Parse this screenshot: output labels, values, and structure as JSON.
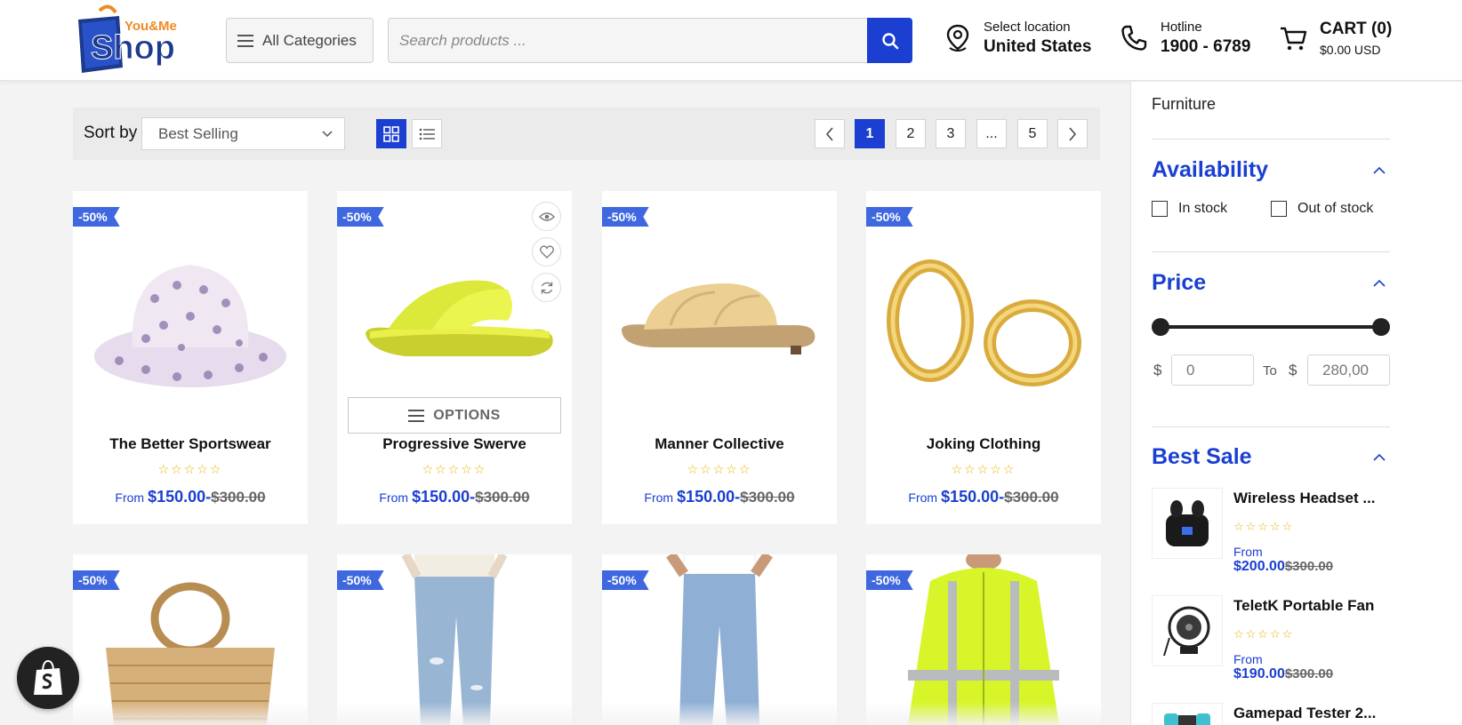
{
  "header": {
    "logo_text_top": "You&Me",
    "logo_text_main": "Shop",
    "categories_label": "All Categories",
    "search_placeholder": "Search products ...",
    "location_label": "Select location",
    "location_value": "United States",
    "hotline_label": "Hotline",
    "hotline_value": "1900 - 6789",
    "cart_label": "CART (0)",
    "cart_total": "$0.00 USD"
  },
  "toolbar": {
    "sort_label": "Sort by",
    "sort_value": "Best Selling",
    "pages": [
      "1",
      "2",
      "3",
      "...",
      "5"
    ],
    "current_page": "1"
  },
  "products": [
    {
      "badge": "-50%",
      "name": "The Better Sportswear",
      "stars": "☆☆☆☆☆",
      "from": "From",
      "price": "$150.00",
      "old_price": "$300.00",
      "image": "bucket-hat"
    },
    {
      "badge": "-50%",
      "name": "Progressive Swerve",
      "stars": "☆☆☆☆☆",
      "from": "From",
      "price": "$150.00",
      "old_price": "$300.00",
      "image": "yellow-sandal",
      "options_label": "OPTIONS"
    },
    {
      "badge": "-50%",
      "name": "Manner Collective",
      "stars": "☆☆☆☆☆",
      "from": "From",
      "price": "$150.00",
      "old_price": "$300.00",
      "image": "beige-slide"
    },
    {
      "badge": "-50%",
      "name": "Joking Clothing",
      "stars": "☆☆☆☆☆",
      "from": "From",
      "price": "$150.00",
      "old_price": "$300.00",
      "image": "gold-earrings"
    },
    {
      "badge": "-50%",
      "image": "straw-bag"
    },
    {
      "badge": "-50%",
      "image": "ripped-jeans"
    },
    {
      "badge": "-50%",
      "image": "mens-jeans"
    },
    {
      "badge": "-50%",
      "image": "hi-vis-jacket"
    }
  ],
  "sidebar": {
    "top_item": "Furniture",
    "availability_title": "Availability",
    "in_stock": "In stock",
    "out_of_stock": "Out of stock",
    "price_title": "Price",
    "currency": "$",
    "to_label": "To",
    "price_min": "0",
    "price_max": "280,00",
    "best_sale_title": "Best Sale",
    "best_sale": [
      {
        "name": "Wireless Headset ...",
        "stars": "☆☆☆☆☆",
        "from": "From",
        "price": "$200.00",
        "old_price": "$300.00"
      },
      {
        "name": "TeletK Portable Fan",
        "stars": "☆☆☆☆☆",
        "from": "From",
        "price": "$190.00",
        "old_price": "$300.00"
      },
      {
        "name": "Gamepad Tester 2..."
      }
    ]
  },
  "colors": {
    "accent": "#1a3fd1",
    "badge": "#3e67e0",
    "star": "#e8b200"
  }
}
